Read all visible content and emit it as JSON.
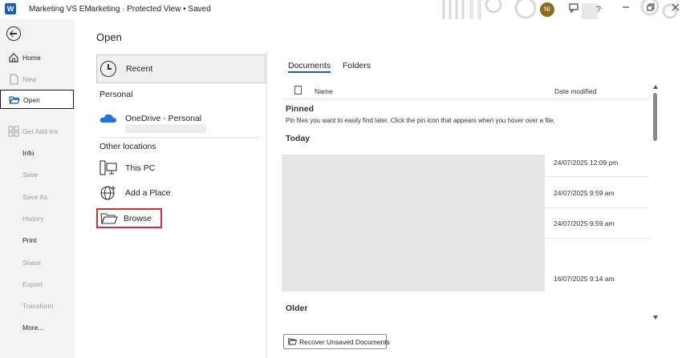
{
  "titlebar": {
    "app_icon": "word-icon",
    "app_letter": "W",
    "title": "Marketing VS EMarketing  ·  Protected View • Saved",
    "avatar_initials": "NI",
    "icons": [
      "feedback-icon",
      "help-icon",
      "minimize-icon",
      "restore-icon",
      "close-icon"
    ]
  },
  "nav": {
    "back_icon": "back-arrow-icon",
    "items": [
      {
        "label": "Home",
        "icon": "home-icon",
        "state": "normal"
      },
      {
        "label": "New",
        "icon": "new-document-icon",
        "state": "disabled"
      },
      {
        "label": "Open",
        "icon": "folder-open-icon",
        "state": "active"
      },
      {
        "label": "Get Add-ins",
        "icon": "add-ins-icon",
        "state": "disabled"
      },
      {
        "label": "Info",
        "state": "normal"
      },
      {
        "label": "Save",
        "state": "disabled"
      },
      {
        "label": "Save As",
        "state": "disabled"
      },
      {
        "label": "History",
        "state": "disabled"
      },
      {
        "label": "Print",
        "state": "normal"
      },
      {
        "label": "Share",
        "state": "disabled"
      },
      {
        "label": "Export",
        "state": "disabled"
      },
      {
        "label": "Transform",
        "state": "disabled"
      },
      {
        "label": "More...",
        "state": "normal"
      }
    ]
  },
  "open": {
    "title": "Open",
    "recent_label": "Recent",
    "personal_header": "Personal",
    "onedrive_label": "OneDrive - Personal",
    "other_header": "Other locations",
    "this_pc_label": "This PC",
    "add_place_label": "Add a Place",
    "browse_label": "Browse"
  },
  "files": {
    "tabs": [
      "Documents",
      "Folders"
    ],
    "active_tab": "Documents",
    "col_name": "Name",
    "col_date": "Date modified",
    "pinned_title": "Pinned",
    "pinned_desc": "Pin files you want to easily find later. Click the pin icon that appears when you hover over a file.",
    "today_title": "Today",
    "dates": [
      "24/07/2025 12:09 pm",
      "24/07/2025 9:59 am",
      "24/07/2025 9:59 am",
      "16/07/2025 9:14 am"
    ],
    "older_title": "Older",
    "recover_label": "Recover Unsaved Documents"
  },
  "colors": {
    "accent": "#185abd",
    "highlight": "#d32f2f",
    "nav_bg": "#f3f3f3"
  }
}
